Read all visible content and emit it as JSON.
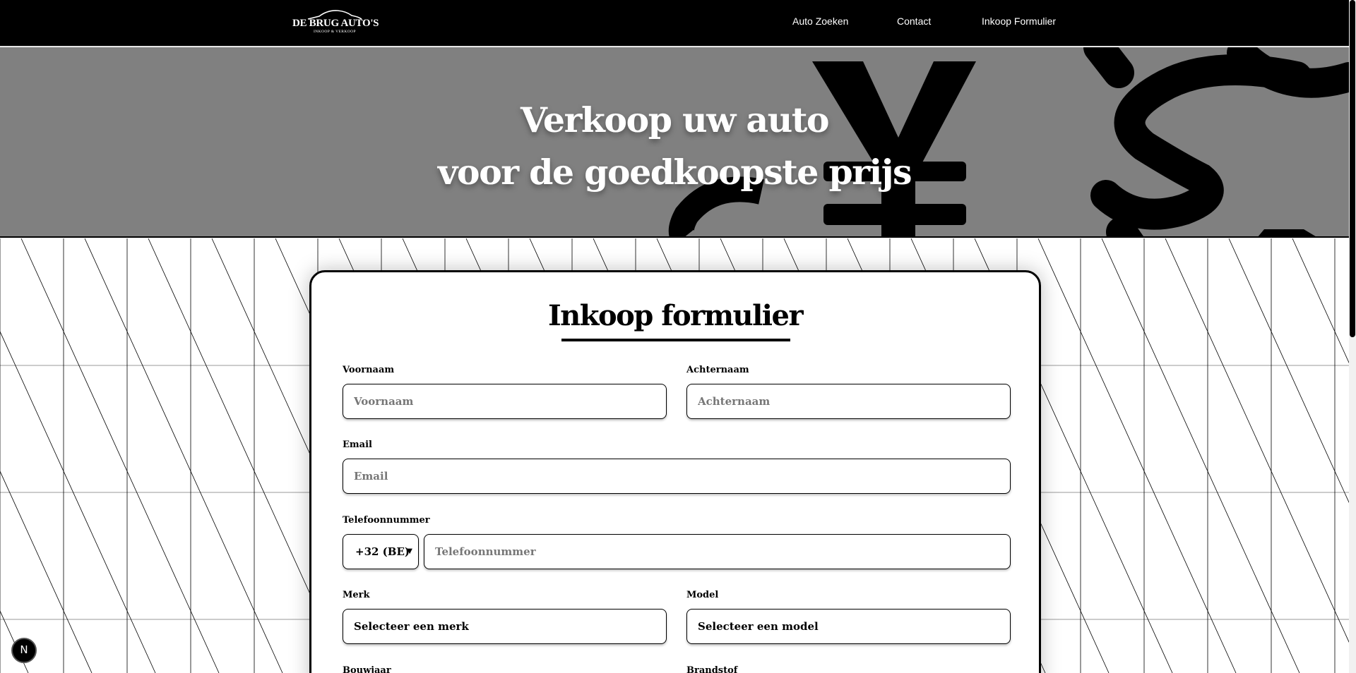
{
  "nav": {
    "logo_main": "DE BRUG AUTO'S",
    "logo_sub": "INKOOP & VERKOOP",
    "links": [
      "Auto Zoeken",
      "Contact",
      "Inkoop Formulier"
    ]
  },
  "hero": {
    "title_line1": "Verkoop uw auto",
    "title_line2": "voor de goedkoopste prijs"
  },
  "form": {
    "title": "Inkoop formulier",
    "voornaam": {
      "label": "Voornaam",
      "placeholder": "Voornaam"
    },
    "achternaam": {
      "label": "Achternaam",
      "placeholder": "Achternaam"
    },
    "email": {
      "label": "Email",
      "placeholder": "Email"
    },
    "telefoon": {
      "label": "Telefoonnummer",
      "country_code": "+32 (BE)",
      "placeholder": "Telefoonnummer"
    },
    "merk": {
      "label": "Merk",
      "value": "Selecteer een merk"
    },
    "model": {
      "label": "Model",
      "value": "Selecteer een model"
    },
    "bouwjaar": {
      "label": "Bouwjaar"
    },
    "brandstof": {
      "label": "Brandstof"
    }
  },
  "badge": {
    "letter": "N"
  },
  "colors": {
    "background": "#ffffff",
    "nav": "#000000",
    "hero": "#808080",
    "accent": "#000000"
  }
}
